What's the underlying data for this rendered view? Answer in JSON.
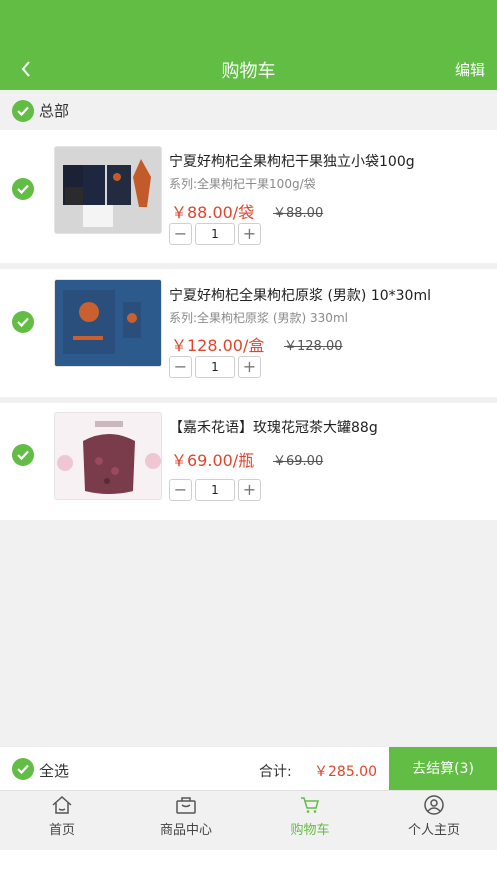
{
  "header": {
    "title": "购物车",
    "edit_label": "编辑",
    "back_icon": "chevron-left-icon"
  },
  "store": {
    "name": "总部",
    "checked": true
  },
  "items": [
    {
      "name": "宁夏好枸杞全果枸杞干果独立小袋100g",
      "spec": "系列:全果枸杞干果100g/袋",
      "price": "￥88.00/袋",
      "old_price": "￥88.00",
      "qty": "1",
      "checked": true
    },
    {
      "name": "宁夏好枸杞全果枸杞原浆 (男款) 10*30ml",
      "spec": "系列:全果枸杞原浆 (男款) 330ml",
      "price": "￥128.00/盒",
      "old_price": "￥128.00",
      "qty": "1",
      "checked": true
    },
    {
      "name": "【嘉禾花语】玫瑰花冠茶大罐88g",
      "spec": "",
      "price": "￥69.00/瓶",
      "old_price": "￥69.00",
      "qty": "1",
      "checked": true
    }
  ],
  "footer": {
    "select_all_label": "全选",
    "total_label": "合计:",
    "total_value": "￥285.00",
    "checkout_label": "去结算(3)"
  },
  "tabs": [
    {
      "label": "首页",
      "icon": "home-icon",
      "active": false
    },
    {
      "label": "商品中心",
      "icon": "shopping-bag-icon",
      "active": false
    },
    {
      "label": "购物车",
      "icon": "cart-icon",
      "active": true
    },
    {
      "label": "个人主页",
      "icon": "user-icon",
      "active": false
    }
  ],
  "colors": {
    "accent": "#62bd45",
    "price": "#e0452c",
    "background": "#f1f1f1"
  }
}
